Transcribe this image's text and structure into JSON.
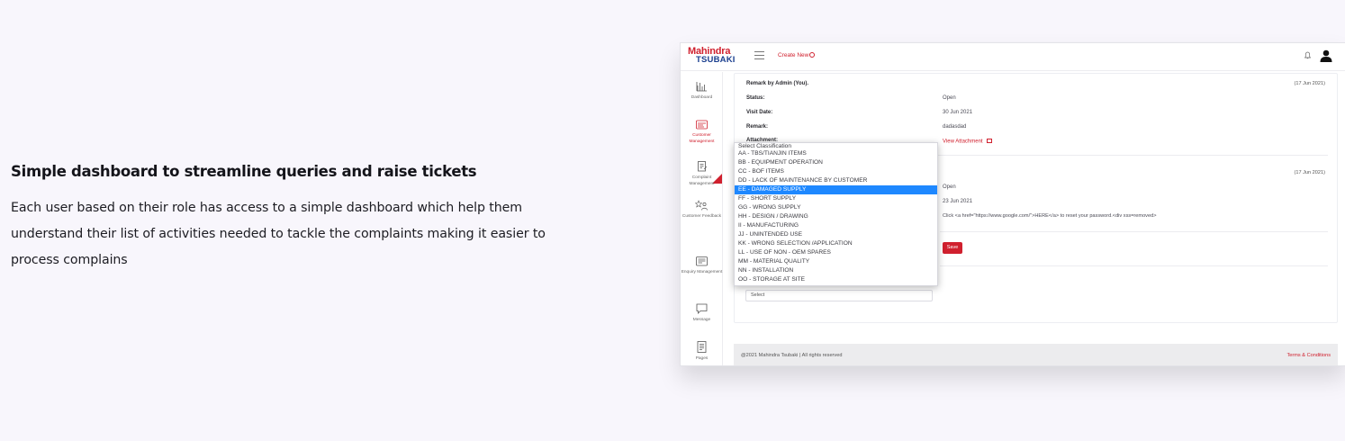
{
  "hero": {
    "title": "Simple dashboard to streamline queries and raise tickets",
    "body": "Each user based on their role has access to a simple dashboard which help them understand their list of activities needed to tackle the complaints making it easier to process complains"
  },
  "app": {
    "logo_line1": "Mahindra",
    "logo_line2": "TSUBAKI",
    "create_new": "Create New",
    "sidebar": [
      {
        "label": "Dashboard",
        "icon": "bar-chart-icon"
      },
      {
        "label": "Customer Management",
        "icon": "id-card-icon",
        "active": true
      },
      {
        "label": "Complaint Management",
        "icon": "clipboard-icon"
      },
      {
        "label": "Customer Feedback",
        "icon": "star-person-icon"
      },
      {
        "label": "Enquiry Management",
        "icon": "form-icon"
      },
      {
        "label": "Message",
        "icon": "chat-bubble-icon"
      },
      {
        "label": "Pages",
        "icon": "document-icon"
      }
    ],
    "remark1": {
      "heading": "Remark by Admin (You).",
      "date": "(17 Jun 2021)",
      "status_label": "Status:",
      "status_value": "Open",
      "visit_label": "Visit Date:",
      "visit_value": "30 Jun 2021",
      "remark_label": "Remark:",
      "remark_value": "dadasdad",
      "attachment_label": "Attachment:",
      "attachment_value": "View Attachment"
    },
    "remark2": {
      "date": "(17 Jun 2021)",
      "status_value": "Open",
      "visit_value": "23 Jun 2021",
      "remark_value": "Click <a href=\"https://www.google.com/\">HERE</a> to reset your password.<div xss=removed>"
    },
    "save_label": "Save",
    "select_value": "Select",
    "dropdown": {
      "placeholder": "Select Classification",
      "options": [
        "AA - TBS/TIANJIN ITEMS",
        "BB - EQUIPMENT OPERATION",
        "CC - BOF ITEMS",
        "DD - LACK OF MAINTENANCE BY CUSTOMER",
        "EE - DAMAGED SUPPLY",
        "FF - SHORT SUPPLY",
        "GG - WRONG SUPPLY",
        "HH - DESIGN / DRAWING",
        "II - MANUFACTURING",
        "JJ - UNINTENDED USE",
        "KK - WRONG SELECTION /APPLICATION",
        "LL - USE OF NON - OEM SPARES",
        "MM - MATERIAL QUALITY",
        "NN - INSTALLATION",
        "OO - STORAGE AT SITE"
      ],
      "selected": "EE - DAMAGED SUPPLY"
    },
    "footer_left": "@2021 Mahindra Tsubaki | All rights reserved",
    "footer_right": "Terms & Conditions",
    "colors": {
      "brand_red": "#d0202e",
      "brand_blue": "#1b3f8f",
      "highlight": "#1e88ff"
    }
  }
}
